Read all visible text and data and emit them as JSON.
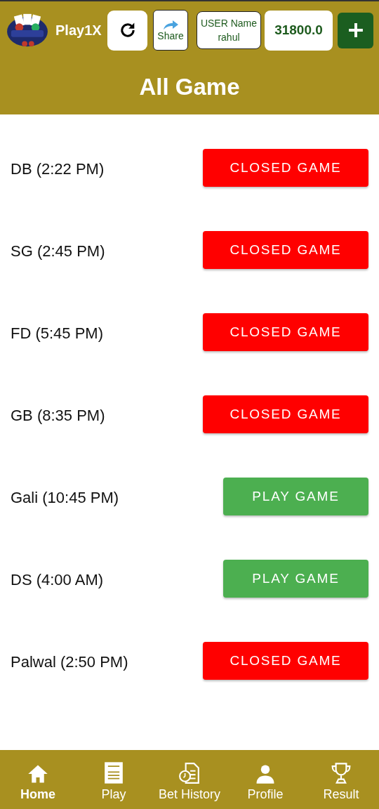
{
  "header": {
    "app_name": "Play1X",
    "share_label": "Share",
    "user_label": "USER Name",
    "user_name": "rahul",
    "balance": "31800.0"
  },
  "title": "All Game",
  "games": [
    {
      "name": "DB (2:22 PM)",
      "kind": "closed",
      "button": "CLOSED GAME"
    },
    {
      "name": "SG (2:45 PM)",
      "kind": "closed",
      "button": "CLOSED GAME"
    },
    {
      "name": "FD (5:45 PM)",
      "kind": "closed",
      "button": "CLOSED GAME"
    },
    {
      "name": "GB (8:35 PM)",
      "kind": "closed",
      "button": "CLOSED GAME"
    },
    {
      "name": "Gali (10:45 PM)",
      "kind": "play",
      "button": "PLAY GAME"
    },
    {
      "name": "DS (4:00 AM)",
      "kind": "play",
      "button": "PLAY GAME"
    },
    {
      "name": "Palwal (2:50 PM)",
      "kind": "closed",
      "button": "CLOSED GAME"
    }
  ],
  "nav": [
    {
      "label": "Home",
      "kind": "home",
      "selected": true
    },
    {
      "label": "Play",
      "kind": "list",
      "selected": false
    },
    {
      "label": "Bet History",
      "kind": "history",
      "selected": false
    },
    {
      "label": "Profile",
      "kind": "person",
      "selected": false
    },
    {
      "label": "Result",
      "kind": "trophy",
      "selected": false
    }
  ]
}
